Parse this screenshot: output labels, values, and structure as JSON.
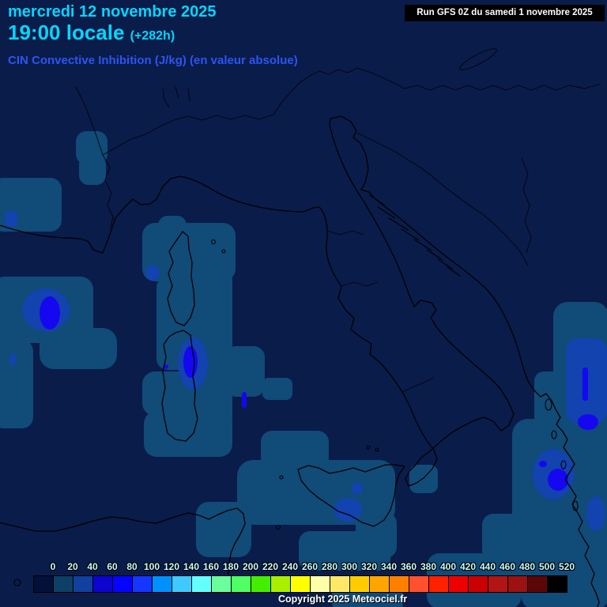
{
  "header": {
    "date": "mercredi 12 novembre 2025",
    "time": "19:00 locale",
    "offset": "(+282h)",
    "subtitle": "CIN Convective Inhibition (J/kg) (en valeur absolue)",
    "run": "Run GFS 0Z du samedi 1 novembre 2025"
  },
  "footer": {
    "copyright": "Copyright 2025 Meteociel.fr"
  },
  "colorbar": {
    "unit": "J/kg",
    "labels": [
      "0",
      "20",
      "40",
      "60",
      "80",
      "100",
      "120",
      "140",
      "160",
      "180",
      "200",
      "220",
      "240",
      "260",
      "280",
      "300",
      "320",
      "340",
      "360",
      "380",
      "400",
      "420",
      "440",
      "460",
      "480",
      "500",
      "520"
    ],
    "cells": [
      "#041038",
      "#0d4066",
      "#11409e",
      "#0d04cf",
      "#0505ff",
      "#1536ff",
      "#0091ff",
      "#3fc9ff",
      "#63ffff",
      "#6bff9c",
      "#50ff63",
      "#44ee00",
      "#aaee00",
      "#ffff00",
      "#ffffaa",
      "#ffe866",
      "#ffcc00",
      "#ffa500",
      "#ff8000",
      "#ff5030",
      "#ff2000",
      "#ee0000",
      "#cc0000",
      "#b31414",
      "#9c1212",
      "#5c0707",
      "#000000"
    ]
  },
  "colors": {
    "title_cyan": "#00d8ff",
    "subtitle_blue": "#2b55f2",
    "run_bg": "#000000",
    "run_text": "#ffffff",
    "scale_label": "#c8fbff",
    "sea": "#0a1c4a",
    "coast": "#000000",
    "cin_low": "#114b78",
    "cin_mid": "#1243ae",
    "cin_high": "#1508f0"
  }
}
